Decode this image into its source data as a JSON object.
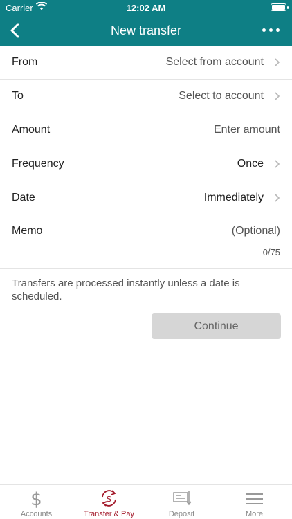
{
  "status": {
    "carrier": "Carrier",
    "time": "12:02 AM"
  },
  "header": {
    "title": "New transfer"
  },
  "form": {
    "from": {
      "label": "From",
      "value": "Select from account"
    },
    "to": {
      "label": "To",
      "value": "Select to account"
    },
    "amount": {
      "label": "Amount",
      "placeholder": "Enter amount"
    },
    "frequency": {
      "label": "Frequency",
      "value": "Once"
    },
    "date": {
      "label": "Date",
      "value": "Immediately"
    },
    "memo": {
      "label": "Memo",
      "placeholder": "(Optional)",
      "counter": "0/75"
    }
  },
  "info_text": "Transfers are processed instantly unless a date is scheduled.",
  "continue_label": "Continue",
  "tabs": [
    {
      "label": "Accounts",
      "icon": "dollar-icon"
    },
    {
      "label": "Transfer & Pay",
      "icon": "transfer-pay-icon"
    },
    {
      "label": "Deposit",
      "icon": "check-deposit-icon"
    },
    {
      "label": "More",
      "icon": "menu-icon"
    }
  ],
  "colors": {
    "header": "#0e7f85",
    "active_tab": "#a3192a",
    "button_disabled": "#d6d6d6"
  }
}
